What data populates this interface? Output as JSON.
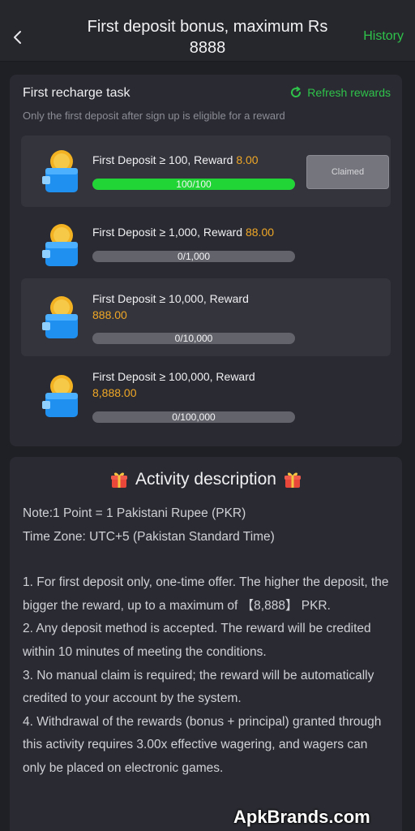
{
  "header": {
    "title": "First deposit bonus, maximum Rs 8888",
    "history_label": "History"
  },
  "task_panel": {
    "title": "First recharge task",
    "refresh_label": "Refresh rewards",
    "subtitle": "Only the first deposit after sign up is eligible for a reward",
    "tiers": [
      {
        "label": "First Deposit ≥ 100, Reward ",
        "reward": "8.00",
        "progress_text": "100/100",
        "progress": 1.0,
        "button_label": "Claimed"
      },
      {
        "label": "First Deposit ≥ 1,000, Reward ",
        "reward": "88.00",
        "progress_text": "0/1,000",
        "progress": 0
      },
      {
        "label": "First Deposit ≥ 10,000, Reward",
        "reward": "888.00",
        "progress_text": "0/10,000",
        "progress": 0
      },
      {
        "label": "First Deposit ≥ 100,000, Reward",
        "reward": "8,888.00",
        "progress_text": "0/100,000",
        "progress": 0
      }
    ]
  },
  "description": {
    "title": "Activity description",
    "note": "Note:1 Point = 1 Pakistani Rupee (PKR)",
    "timezone": "Time Zone: UTC+5 (Pakistan Standard Time)",
    "rules": [
      "1. For first deposit only, one-time offer. The higher the deposit, the bigger the reward, up to a maximum of 【8,888】 PKR.",
      "2. Any deposit method is accepted. The reward will be credited within 10 minutes of meeting the conditions.",
      "3. No manual claim is required; the reward will be automatically credited to your account by the system.",
      "4. Withdrawal of the rewards (bonus + principal) granted through this activity requires 3.00x effective wagering, and wagers can only be placed on electronic games."
    ]
  },
  "watermark": "ApkBrands.com",
  "colors": {
    "accent_green": "#2fc24a",
    "reward_orange": "#f0a726",
    "progress_fill": "#22d536",
    "background": "#1f2026",
    "panel": "#2a2b32"
  },
  "icons": [
    "back-chevron-icon",
    "refresh-icon",
    "wallet-coin-icon",
    "gift-icon"
  ]
}
